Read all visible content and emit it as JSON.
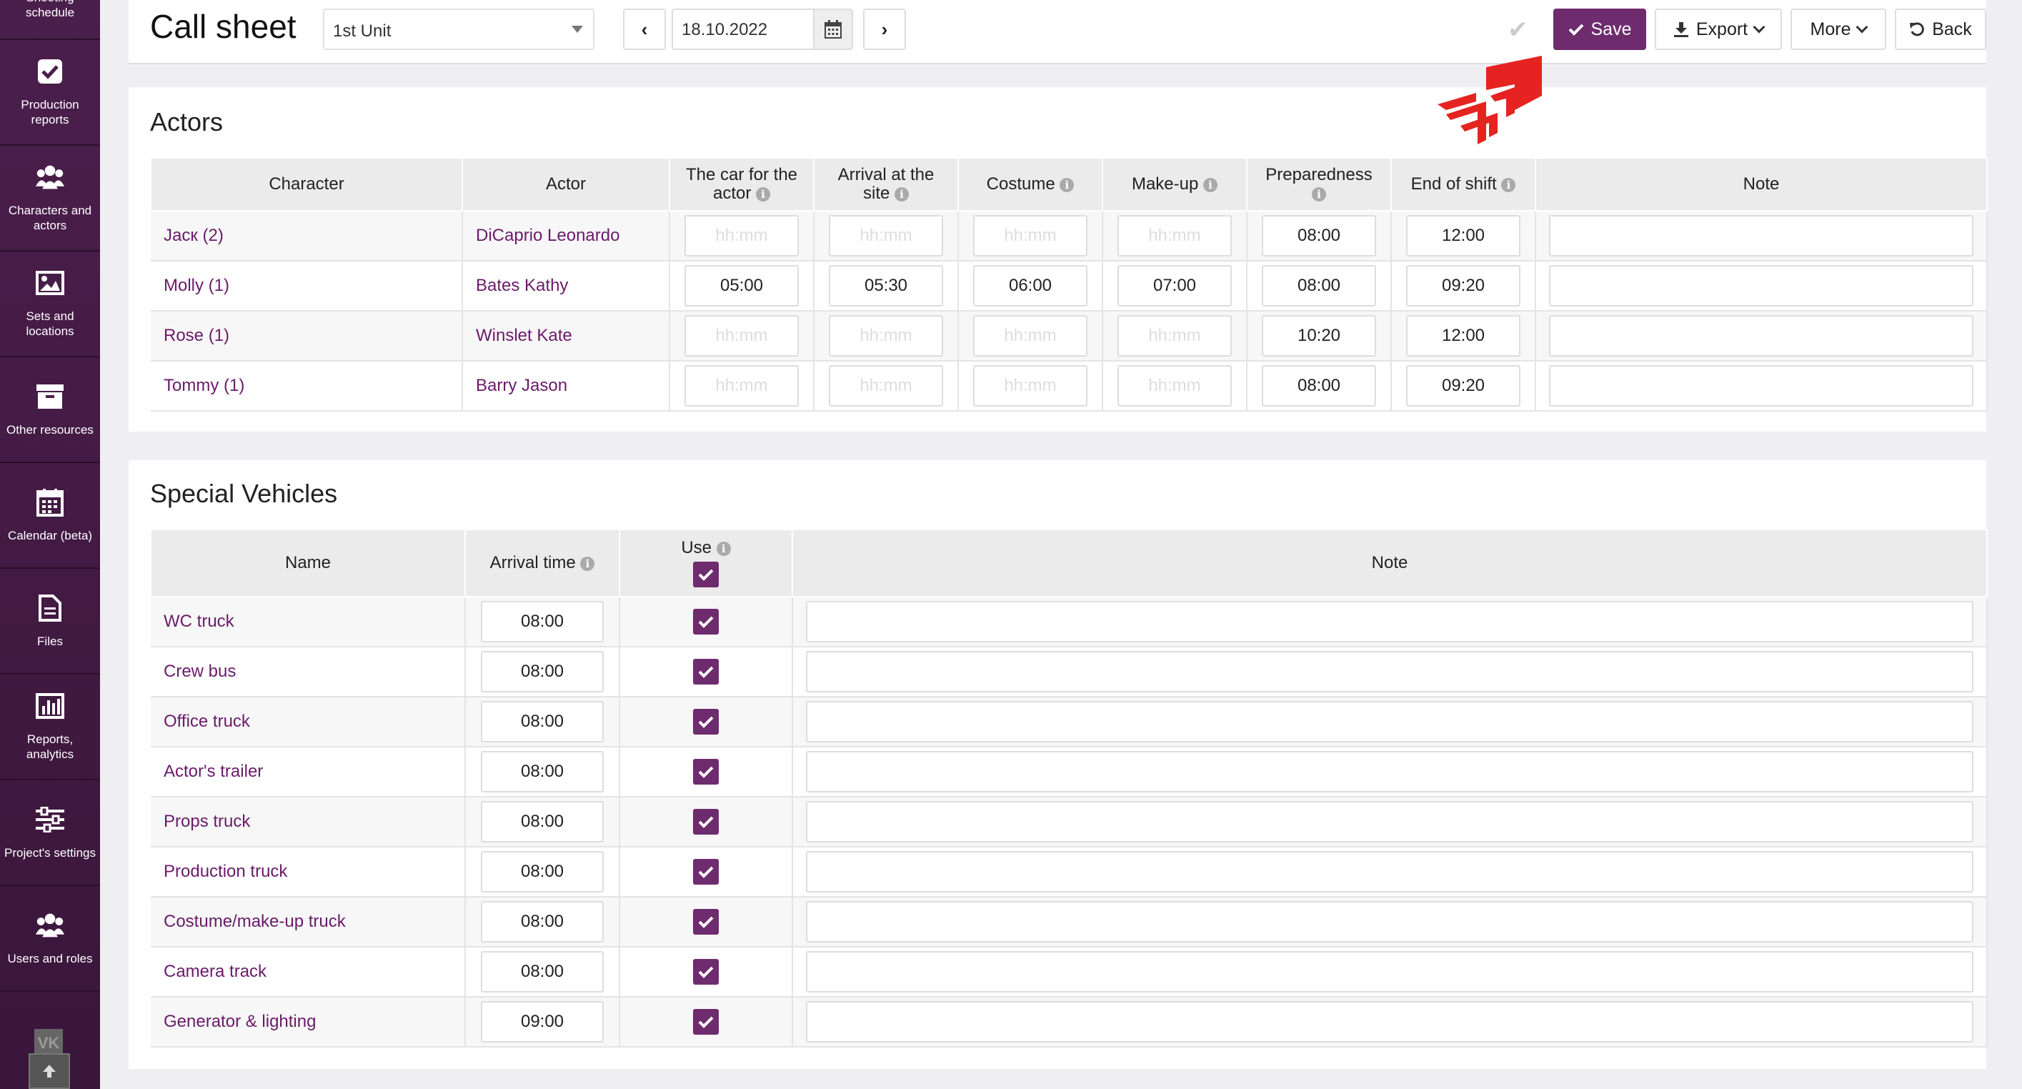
{
  "sidebar": {
    "items": [
      {
        "label": "Shooting schedule",
        "icon": "calendar-icon"
      },
      {
        "label": "Production reports",
        "icon": "checkbox-icon"
      },
      {
        "label": "Characters and actors",
        "icon": "users-icon"
      },
      {
        "label": "Sets and locations",
        "icon": "image-icon"
      },
      {
        "label": "Other resources",
        "icon": "archive-icon"
      },
      {
        "label": "Calendar (beta)",
        "icon": "calendar-icon"
      },
      {
        "label": "Files",
        "icon": "file-icon"
      },
      {
        "label": "Reports, analytics",
        "icon": "bar-chart-icon"
      },
      {
        "label": "Project's settings",
        "icon": "sliders-icon"
      },
      {
        "label": "Users and roles",
        "icon": "users-icon"
      }
    ],
    "vk_label": "VK"
  },
  "header": {
    "title": "Call sheet",
    "unit": "1st Unit",
    "prev_label": "‹",
    "next_label": "›",
    "date": "18.10.2022",
    "save_label": "Save",
    "export_label": "Export",
    "more_label": "More",
    "back_label": "Back"
  },
  "colors": {
    "accent": "#6e2c6e",
    "sidebar": "#4b1f4c",
    "link": "#6a1b6a",
    "logo": "#e52320"
  },
  "actors": {
    "title": "Actors",
    "headers": {
      "character": "Character",
      "actor": "Actor",
      "car_line1": "The car for the",
      "car_line2": "actor",
      "arrival_line1": "Arrival at the",
      "arrival_line2": "site",
      "costume": "Costume",
      "makeup": "Make-up",
      "preparedness": "Preparedness",
      "end_of_shift": "End of shift",
      "note": "Note"
    },
    "placeholder": "hh:mm",
    "rows": [
      {
        "character": "Jacк (2)",
        "actor": "DiCaprio Leonardo",
        "car": "",
        "arrival": "",
        "costume": "",
        "makeup": "",
        "preparedness": "08:00",
        "end": "12:00",
        "note": ""
      },
      {
        "character": "Molly (1)",
        "actor": "Bates Kathy",
        "car": "05:00",
        "arrival": "05:30",
        "costume": "06:00",
        "makeup": "07:00",
        "preparedness": "08:00",
        "end": "09:20",
        "note": ""
      },
      {
        "character": "Rose (1)",
        "actor": "Winslet Kate",
        "car": "",
        "arrival": "",
        "costume": "",
        "makeup": "",
        "preparedness": "10:20",
        "end": "12:00",
        "note": ""
      },
      {
        "character": "Tommy (1)",
        "actor": "Barry Jason",
        "car": "",
        "arrival": "",
        "costume": "",
        "makeup": "",
        "preparedness": "08:00",
        "end": "09:20",
        "note": ""
      }
    ]
  },
  "vehicles": {
    "title": "Special Vehicles",
    "headers": {
      "name": "Name",
      "arrival": "Arrival time",
      "use": "Use",
      "note": "Note"
    },
    "rows": [
      {
        "name": "WC truck",
        "arrival": "08:00",
        "use": true
      },
      {
        "name": "Crew bus",
        "arrival": "08:00",
        "use": true
      },
      {
        "name": "Office truck",
        "arrival": "08:00",
        "use": true
      },
      {
        "name": "Actor's trailer",
        "arrival": "08:00",
        "use": true
      },
      {
        "name": "Props truck",
        "arrival": "08:00",
        "use": true
      },
      {
        "name": "Production truck",
        "arrival": "08:00",
        "use": true
      },
      {
        "name": "Costume/make-up truck",
        "arrival": "08:00",
        "use": true
      },
      {
        "name": "Camera track",
        "arrival": "08:00",
        "use": true
      },
      {
        "name": "Generator & lighting",
        "arrival": "09:00",
        "use": true
      }
    ]
  }
}
